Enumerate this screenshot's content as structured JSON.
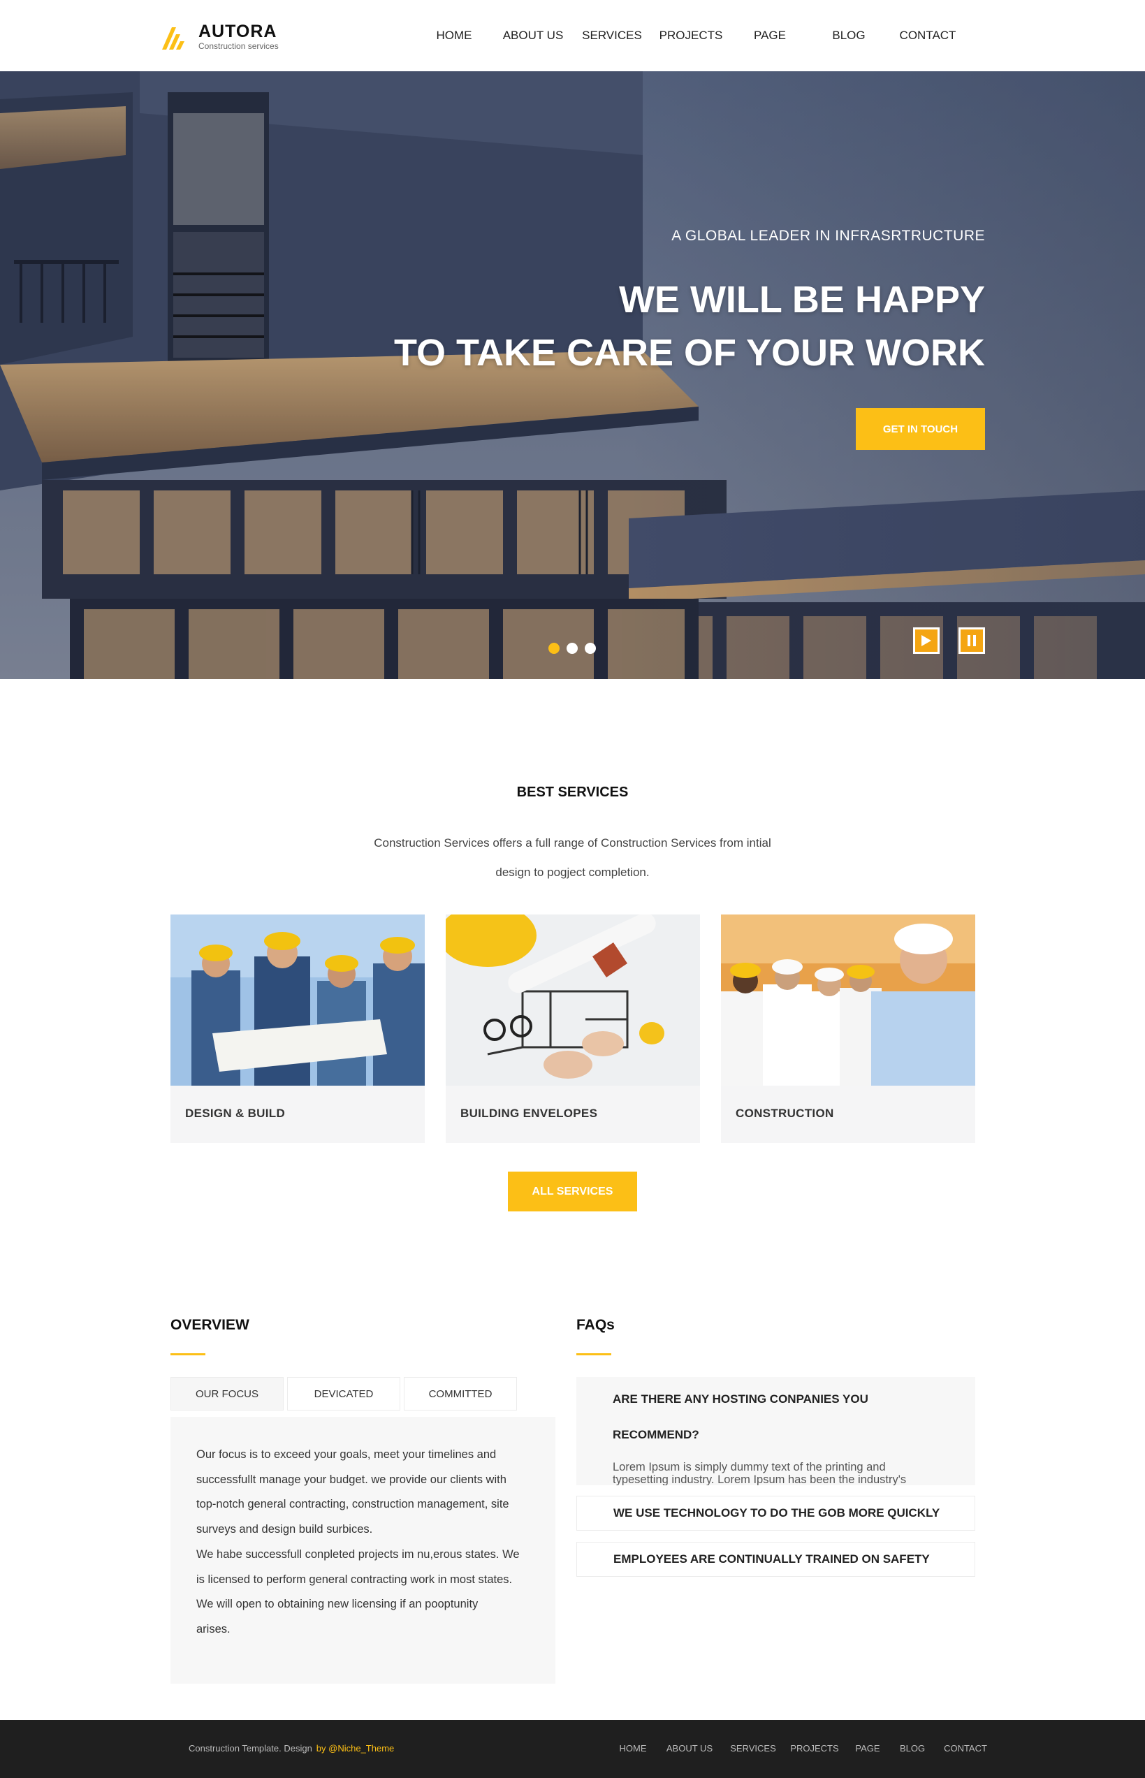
{
  "brand": {
    "name": "AUTORA",
    "tagline": "Construction services",
    "accent_color": "#fcbf16"
  },
  "nav": [
    "HOME",
    "ABOUT US",
    "SERVICES",
    "PROJECTS",
    "PAGE",
    "BLOG",
    "CONTACT"
  ],
  "hero": {
    "subtitle": "A GLOBAL LEADER IN INFRASRTRUCTURE",
    "title_line1": "WE WILL BE HAPPY",
    "title_line2": "TO TAKE CARE OF YOUR WORK",
    "button": "GET IN TOUCH",
    "slides": 3,
    "active_slide": 1
  },
  "services": {
    "title": "BEST SERVICES",
    "desc_line1": "Construction Services offers a full range of Construction Services from intial",
    "desc_line2": "design to pogject completion.",
    "cards": [
      {
        "label": "DESIGN & BUILD"
      },
      {
        "label": "BUILDING ENVELOPES"
      },
      {
        "label": "CONSTRUCTION"
      }
    ],
    "button": "ALL SERVICES"
  },
  "overview": {
    "title": "OVERVIEW",
    "tabs": [
      "OUR FOCUS",
      "DEVICATED",
      "COMMITTED"
    ],
    "active_tab": 0,
    "lines": [
      "Our focus is to exceed your goals, meet your timelines and",
      "successfullt manage your budget. we provide our clients with",
      "top-notch general contracting, construction management, site",
      "surveys and design build surbices.",
      "We habe successfull conpleted projects im nu,erous states. We",
      "is licensed to perform general contracting work in most states.",
      "We will open to obtaining new licensing if an pooptunity",
      "arises."
    ]
  },
  "faq": {
    "title": "FAQs",
    "open_question": "ARE THERE ANY HOSTING CONPANIES YOU RECOMMEND?",
    "open_answer": "Lorem Ipsum is simply dummy text of the printing and typesetting industry. Lorem Ipsum has been the industry's",
    "items": [
      "WE USE TECHNOLOGY TO DO THE GOB MORE QUICKLY",
      "EMPLOYEES ARE CONTINUALLY TRAINED ON SAFETY"
    ]
  },
  "footer": {
    "credit": "Construction Template. Design",
    "author": "by @Niche_Theme",
    "nav": [
      "HOME",
      "ABOUT US",
      "SERVICES",
      "PROJECTS",
      "PAGE",
      "BLOG",
      "CONTACT"
    ]
  }
}
